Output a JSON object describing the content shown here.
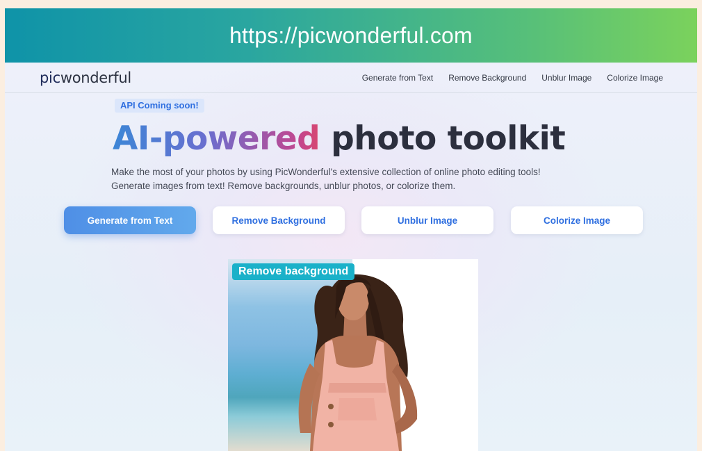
{
  "browser": {
    "url": "https://picwonderful.com"
  },
  "header": {
    "logo_prefix": "pic",
    "logo_suffix": "wonderful",
    "nav": [
      {
        "label": "Generate from Text"
      },
      {
        "label": "Remove Background"
      },
      {
        "label": "Unblur Image"
      },
      {
        "label": "Colorize Image"
      }
    ]
  },
  "hero": {
    "badge": "API Coming soon!",
    "headline_gradient": "AI-powered",
    "headline_plain": " photo toolkit",
    "description_line1": "Make the most of your photos by using PicWonderful's extensive collection of online photo editing tools!",
    "description_line2": "Generate images from text! Remove backgrounds, unblur photos, or colorize them.",
    "buttons": [
      {
        "label": "Generate from Text",
        "style": "primary"
      },
      {
        "label": "Remove Background",
        "style": "secondary"
      },
      {
        "label": "Unblur Image",
        "style": "secondary"
      },
      {
        "label": "Colorize Image",
        "style": "secondary"
      }
    ]
  },
  "demo": {
    "label": "Remove background"
  },
  "colors": {
    "brand_blue": "#2f6fe0",
    "label_cyan": "#1ab1c9",
    "urlbar_start": "#0f93a8",
    "urlbar_end": "#7bd25c"
  }
}
